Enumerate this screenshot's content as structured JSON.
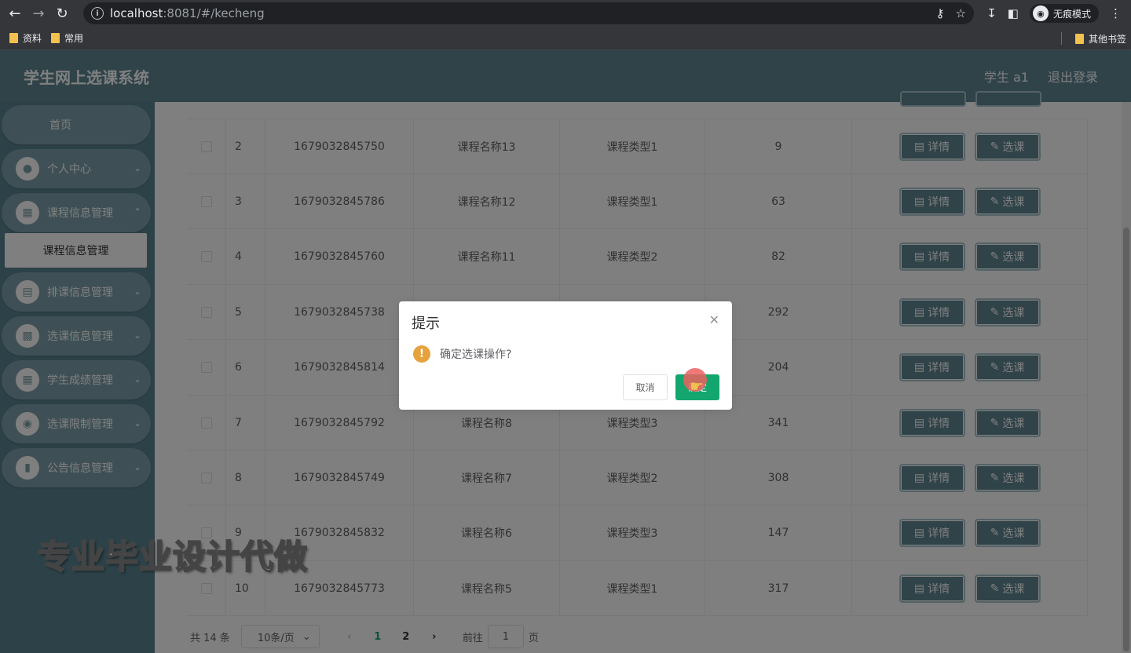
{
  "browser": {
    "url_host": "localhost",
    "url_path": ":8081/#/kecheng",
    "incognito_label": "无痕模式",
    "bookmarks": [
      "资料",
      "常用"
    ],
    "other_bookmarks": "其他书签"
  },
  "header": {
    "title": "学生网上选课系统",
    "user": "学生 a1",
    "logout": "退出登录"
  },
  "sidebar": {
    "items": [
      {
        "label": "首页",
        "icon": "home"
      },
      {
        "label": "个人中心",
        "icon": "user-icon"
      },
      {
        "label": "课程信息管理",
        "icon": "grid-icon"
      },
      {
        "label": "排课信息管理",
        "icon": "chart-icon"
      },
      {
        "label": "选课信息管理",
        "icon": "monitor-icon"
      },
      {
        "label": "学生成绩管理",
        "icon": "grid-icon"
      },
      {
        "label": "选课限制管理",
        "icon": "bulb-icon"
      },
      {
        "label": "公告信息管理",
        "icon": "chat-icon"
      }
    ],
    "submenu_label": "课程信息管理"
  },
  "table": {
    "rows": [
      {
        "idx": "2",
        "code": "1679032845750",
        "name": "课程名称13",
        "type": "课程类型1",
        "num": "9"
      },
      {
        "idx": "3",
        "code": "1679032845786",
        "name": "课程名称12",
        "type": "课程类型1",
        "num": "63"
      },
      {
        "idx": "4",
        "code": "1679032845760",
        "name": "课程名称11",
        "type": "课程类型2",
        "num": "82"
      },
      {
        "idx": "5",
        "code": "1679032845738",
        "name": "",
        "type": "",
        "num": "292"
      },
      {
        "idx": "6",
        "code": "1679032845814",
        "name": "",
        "type": "",
        "num": "204"
      },
      {
        "idx": "7",
        "code": "1679032845792",
        "name": "课程名称8",
        "type": "课程类型3",
        "num": "341"
      },
      {
        "idx": "8",
        "code": "1679032845749",
        "name": "课程名称7",
        "type": "课程类型2",
        "num": "308"
      },
      {
        "idx": "9",
        "code": "1679032845832",
        "name": "课程名称6",
        "type": "课程类型3",
        "num": "147"
      },
      {
        "idx": "10",
        "code": "1679032845773",
        "name": "课程名称5",
        "type": "课程类型1",
        "num": "317"
      }
    ],
    "detail_label": "详情",
    "select_label": "选课"
  },
  "pagination": {
    "total": "共 14 条",
    "page_size": "10条/页",
    "pages": [
      "1",
      "2"
    ],
    "active_page": "1",
    "goto_label": "前往",
    "goto_value": "1",
    "page_suffix": "页"
  },
  "dialog": {
    "title": "提示",
    "message": "确定选课操作?",
    "cancel": "取消",
    "confirm": "确定"
  },
  "watermark": "专业毕业设计代做",
  "colors": {
    "accent": "#5e8793",
    "confirm": "#13a66f",
    "warning": "#e6a23c"
  }
}
